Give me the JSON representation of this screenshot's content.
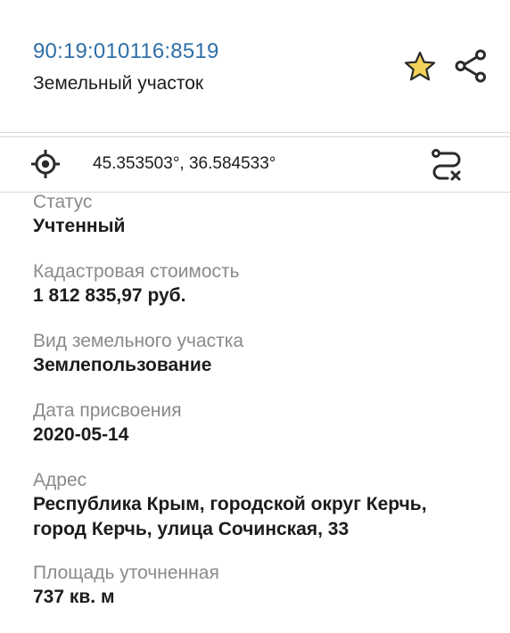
{
  "header": {
    "cadastral_number": "90:19:010116:8519",
    "object_type": "Земельный участок"
  },
  "coords": {
    "text": "45.353503°, 36.584533°"
  },
  "properties": [
    {
      "label": "Статус",
      "value": "Учтенный"
    },
    {
      "label": "Кадастровая стоимость",
      "value": "1 812 835,97 руб."
    },
    {
      "label": "Вид земельного участка",
      "value": "Землепользование"
    },
    {
      "label": "Дата присвоения",
      "value": "2020-05-14"
    },
    {
      "label": "Адрес",
      "value_line1": "Республика Крым, городской округ Керчь,",
      "value_line2": "город Керчь, улица Сочинская, 33"
    },
    {
      "label": "Площадь уточненная",
      "value": "737 кв. м"
    }
  ],
  "icons": {
    "star": "star-icon",
    "share": "share-icon",
    "locate": "crosshair-icon",
    "route": "route-clear-icon"
  },
  "colors": {
    "link_blue": "#2f6fa8",
    "star_fill": "#f2d25a",
    "label_gray": "#8a8a8e"
  }
}
